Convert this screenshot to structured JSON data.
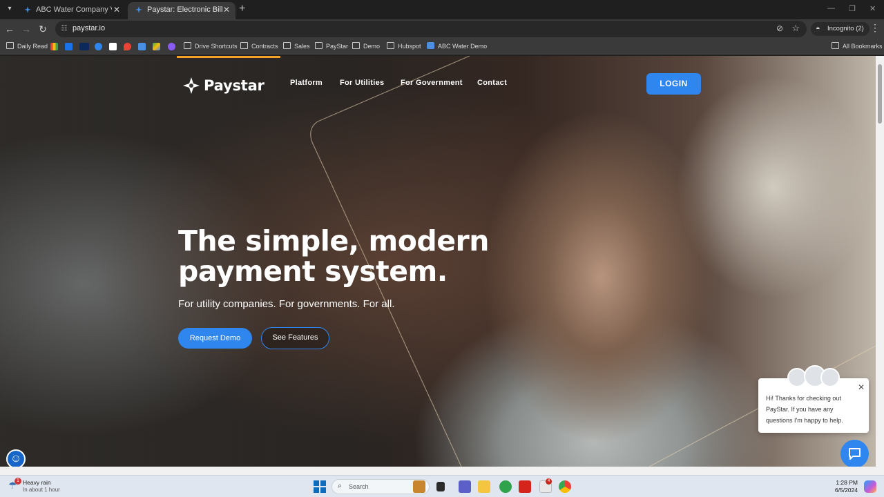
{
  "browser": {
    "tabs": [
      {
        "title": "ABC Water Company View and",
        "active": false
      },
      {
        "title": "Paystar: Electronic Bill Presenta",
        "active": true
      }
    ],
    "url": "paystar.io",
    "profile": "Incognito (2)",
    "bookmarks": [
      {
        "label": "Daily Read",
        "icon": "folder-icon"
      },
      {
        "label": "Drive Shortcuts",
        "icon": "folder-icon"
      },
      {
        "label": "Contracts",
        "icon": "folder-icon"
      },
      {
        "label": "Sales",
        "icon": "folder-icon"
      },
      {
        "label": "PayStar",
        "icon": "folder-icon"
      },
      {
        "label": "Demo",
        "icon": "folder-icon"
      },
      {
        "label": "Hubspot",
        "icon": "folder-icon"
      },
      {
        "label": "ABC Water Demo",
        "icon": "paystar-logo-icon"
      }
    ],
    "all_bookmarks": "All Bookmarks"
  },
  "site": {
    "brand": "Paystar",
    "nav": [
      "Platform",
      "For Utilities",
      "For Government",
      "Contact"
    ],
    "login": "LOGIN",
    "hero_title": "The simple, modern payment system.",
    "hero_subtitle": "For utility companies. For governments. For all.",
    "cta_primary": "Request Demo",
    "cta_secondary": "See Features",
    "chat_message": "Hi! Thanks for checking out PayStar. If you have any questions I'm happy to help.",
    "accent_color": "#2f86ee",
    "highlight_color": "#f2a12b"
  },
  "taskbar": {
    "weather_title": "Heavy rain",
    "weather_sub": "In about 1 hour",
    "weather_badge": "1",
    "search_placeholder": "Search",
    "time": "1:28 PM",
    "date": "6/5/2024",
    "teams_badge": "4"
  }
}
